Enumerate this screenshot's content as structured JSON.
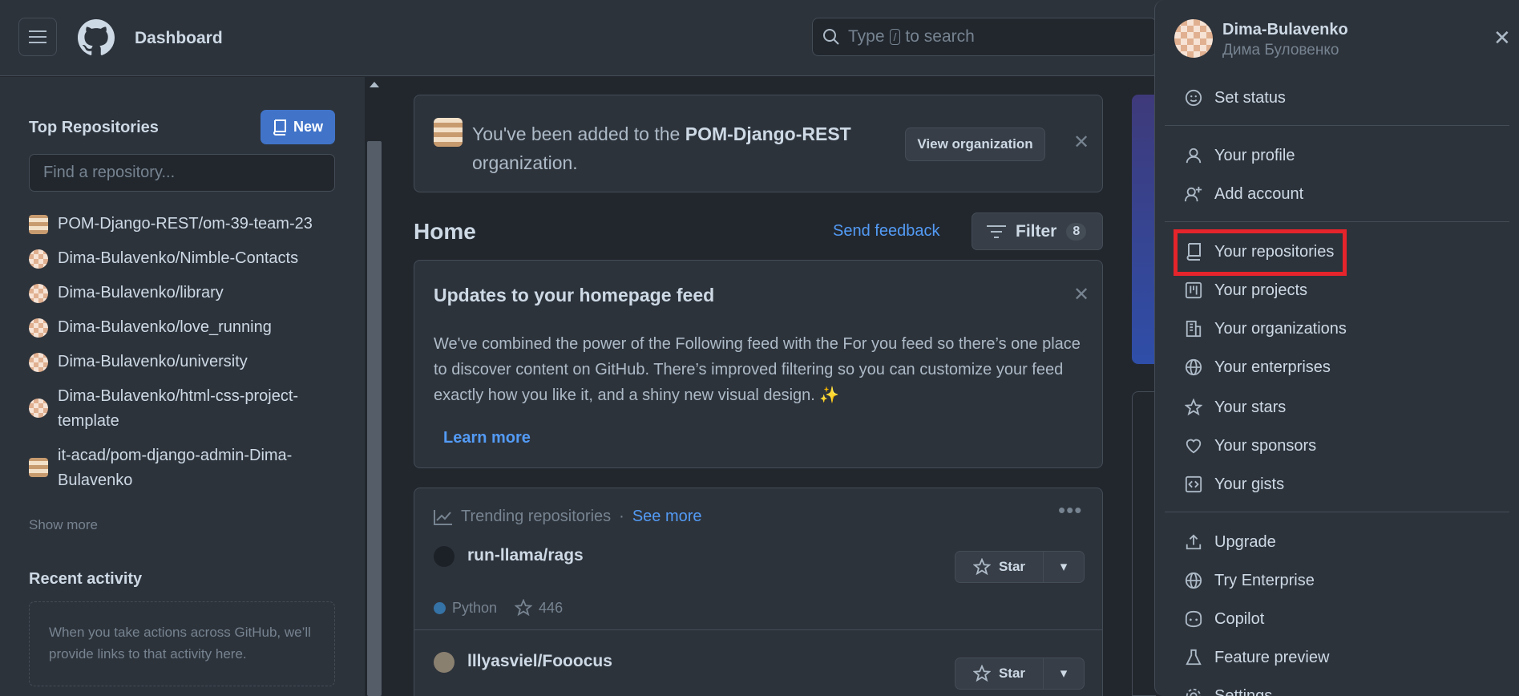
{
  "header": {
    "title": "Dashboard",
    "search_pre": "Type",
    "search_key": "/",
    "search_post": "to search"
  },
  "sidebar": {
    "top_repos_title": "Top Repositories",
    "new_label": "New",
    "find_placeholder": "Find a repository...",
    "repos": [
      "POM-Django-REST/om-39-team-23",
      "Dima-Bulavenko/Nimble-Contacts",
      "Dima-Bulavenko/library",
      "Dima-Bulavenko/love_running",
      "Dima-Bulavenko/university",
      "Dima-Bulavenko/html-css-project-template",
      "it-acad/pom-django-admin-Dima-Bulavenko"
    ],
    "show_more": "Show more",
    "recent_title": "Recent activity",
    "recent_text": "When you take actions across GitHub, we’ll provide links to that activity here."
  },
  "notice": {
    "pre": "You've been added to the",
    "org": "POM-Django-REST",
    "post": "organization.",
    "button": "View organization"
  },
  "home": {
    "title": "Home",
    "feedback": "Send feedback",
    "filter": "Filter",
    "filter_count": "8"
  },
  "updates": {
    "title": "Updates to your homepage feed",
    "body": "We've combined the power of the Following feed with the For you feed so there’s one place to discover content on GitHub. There’s improved filtering so you can customize your feed exactly how you like it, and a shiny new visual design. ✨",
    "learn": "Learn more"
  },
  "trending": {
    "title": "Trending repositories",
    "sep": "·",
    "see_more": "See more",
    "repos": [
      {
        "name": "run-llama/rags",
        "lang": "Python",
        "stars": "446",
        "star_label": "Star"
      },
      {
        "name": "lllyasviel/Fooocus",
        "star_label": "Star"
      }
    ]
  },
  "menu": {
    "username": "Dima-Bulavenko",
    "fullname": "Дима Буловенко",
    "items": [
      "Set status",
      "Your profile",
      "Add account",
      "Your repositories",
      "Your projects",
      "Your organizations",
      "Your enterprises",
      "Your stars",
      "Your sponsors",
      "Your gists",
      "Upgrade",
      "Try Enterprise",
      "Copilot",
      "Feature preview",
      "Settings"
    ]
  },
  "colors": {
    "accent": "#539bf5",
    "new_button": "#4174c9",
    "highlight": "#e5242b"
  }
}
